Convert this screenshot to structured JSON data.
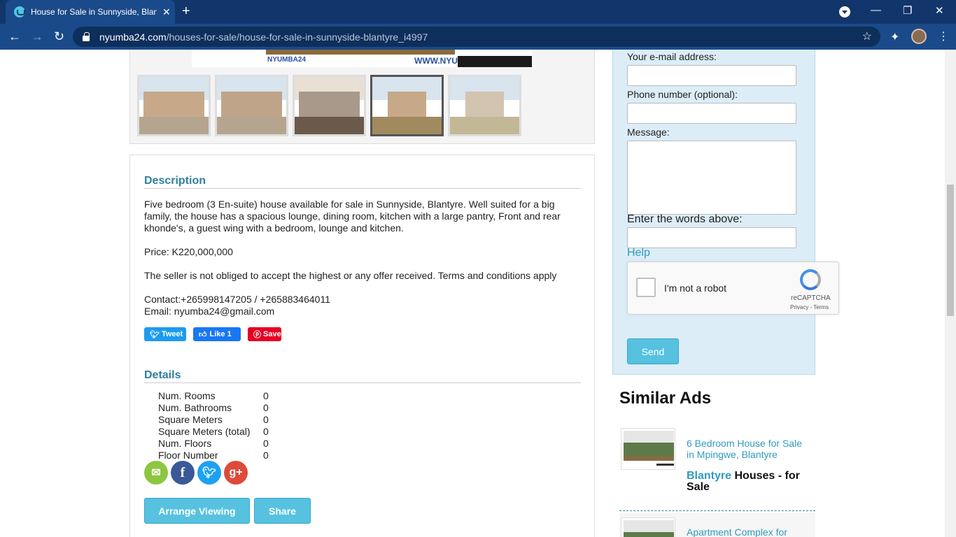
{
  "browser": {
    "tab_title": "House for Sale in Sunnyside, Blan",
    "url_host": "nyumba24.com",
    "url_path": "/houses-for-sale/house-for-sale-in-sunnyside-blantyre_i4997"
  },
  "banner": {
    "logo_text": "NYUMBA24",
    "website_text": "WWW.NYUMBA24.COM"
  },
  "description": {
    "heading": "Description",
    "para1": "Five bedroom (3 En-suite) house available for sale in Sunnyside, Blantyre. Well suited for a big family, the house has a spacious lounge, dining room, kitchen with a large pantry, Front and rear khonde's, a guest wing with a bedroom, lounge and kitchen.",
    "price": "Price: K220,000,000",
    "terms": "The seller is not obliged to accept the highest or any offer received. Terms and conditions apply",
    "contact": "Contact:+265998147205 / +265883464011",
    "email": "Email: nyumba24@gmail.com"
  },
  "social": {
    "tweet": "Tweet",
    "like": "Like 1",
    "save": "Save"
  },
  "details": {
    "heading": "Details",
    "rows": [
      {
        "key": "Num. Rooms",
        "value": "0"
      },
      {
        "key": "Num. Bathrooms",
        "value": "0"
      },
      {
        "key": "Square Meters",
        "value": "0"
      },
      {
        "key": "Square Meters (total)",
        "value": "0"
      },
      {
        "key": "Num. Floors",
        "value": "0"
      },
      {
        "key": "Floor Number",
        "value": "0"
      }
    ]
  },
  "actions": {
    "arrange": "Arrange Viewing",
    "share": "Share"
  },
  "contact_form": {
    "email_label": "Your e-mail address:",
    "phone_label": "Phone number (optional):",
    "message_label": "Message:",
    "captcha_label": "Enter the words above:",
    "help": "Help",
    "robot": "I'm not a robot",
    "recaptcha": "reCAPTCHA",
    "privacy_terms": "Privacy - Terms",
    "send": "Send"
  },
  "similar": {
    "heading": "Similar Ads",
    "ad1_title": "6 Bedroom House for Sale in Mpingwe, Blantyre",
    "ad1_city": "Blantyre",
    "ad1_category": "Houses - for Sale",
    "ad2_title": "Apartment Complex for"
  },
  "colors": {
    "accent": "#2f9bbf",
    "button": "#56c2e0",
    "form_bg": "#dcedf7"
  }
}
